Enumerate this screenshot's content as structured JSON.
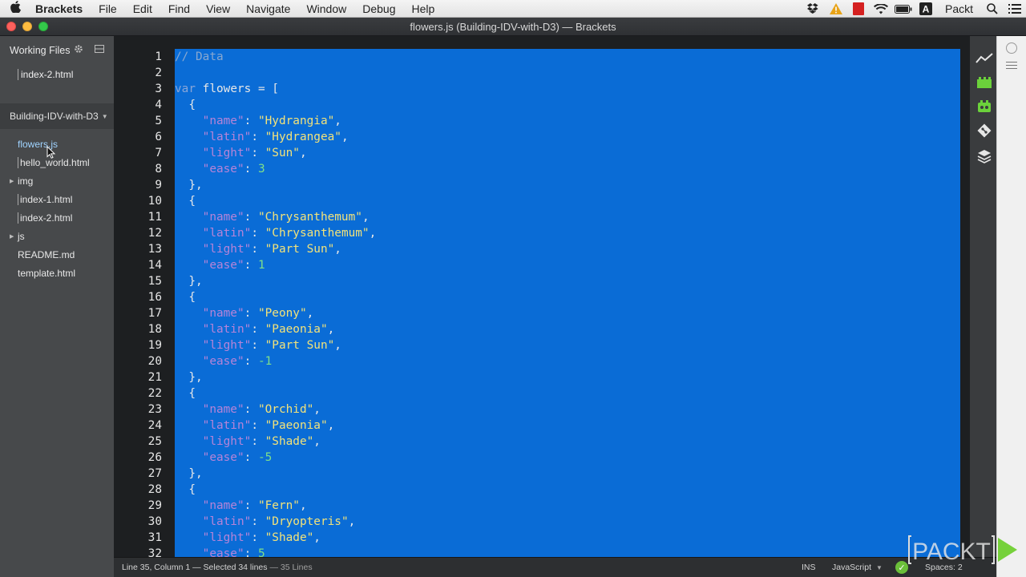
{
  "menubar": {
    "app_name": "Brackets",
    "items": [
      "File",
      "Edit",
      "Find",
      "View",
      "Navigate",
      "Window",
      "Debug",
      "Help"
    ],
    "status_user": "Packt"
  },
  "window": {
    "title": "flowers.js (Building-IDV-with-D3) — Brackets"
  },
  "sidebar": {
    "working_files_label": "Working Files",
    "working_files": [
      "index-2.html"
    ],
    "project_name": "Building-IDV-with-D3",
    "tree": [
      {
        "label": "flowers.js",
        "type": "file",
        "selected": true
      },
      {
        "label": "hello_world.html",
        "type": "file"
      },
      {
        "label": "img",
        "type": "folder"
      },
      {
        "label": "index-1.html",
        "type": "file"
      },
      {
        "label": "index-2.html",
        "type": "file"
      },
      {
        "label": "js",
        "type": "folder"
      },
      {
        "label": "README.md",
        "type": "file"
      },
      {
        "label": "template.html",
        "type": "file"
      }
    ]
  },
  "editor": {
    "lines": [
      [
        [
          "comment",
          "// Data"
        ]
      ],
      [],
      [
        [
          "kw",
          "var"
        ],
        [
          "punc",
          " flowers = ["
        ]
      ],
      [
        [
          "punc",
          "  {"
        ]
      ],
      [
        [
          "key",
          "    \"name\""
        ],
        [
          "punc",
          ": "
        ],
        [
          "str",
          "\"Hydrangia\""
        ],
        [
          "punc",
          ","
        ]
      ],
      [
        [
          "key",
          "    \"latin\""
        ],
        [
          "punc",
          ": "
        ],
        [
          "str",
          "\"Hydrangea\""
        ],
        [
          "punc",
          ","
        ]
      ],
      [
        [
          "key",
          "    \"light\""
        ],
        [
          "punc",
          ": "
        ],
        [
          "str",
          "\"Sun\""
        ],
        [
          "punc",
          ","
        ]
      ],
      [
        [
          "key",
          "    \"ease\""
        ],
        [
          "punc",
          ": "
        ],
        [
          "num",
          "3"
        ]
      ],
      [
        [
          "punc",
          "  },"
        ]
      ],
      [
        [
          "punc",
          "  {"
        ]
      ],
      [
        [
          "key",
          "    \"name\""
        ],
        [
          "punc",
          ": "
        ],
        [
          "str",
          "\"Chrysanthemum\""
        ],
        [
          "punc",
          ","
        ]
      ],
      [
        [
          "key",
          "    \"latin\""
        ],
        [
          "punc",
          ": "
        ],
        [
          "str",
          "\"Chrysanthemum\""
        ],
        [
          "punc",
          ","
        ]
      ],
      [
        [
          "key",
          "    \"light\""
        ],
        [
          "punc",
          ": "
        ],
        [
          "str",
          "\"Part Sun\""
        ],
        [
          "punc",
          ","
        ]
      ],
      [
        [
          "key",
          "    \"ease\""
        ],
        [
          "punc",
          ": "
        ],
        [
          "num",
          "1"
        ]
      ],
      [
        [
          "punc",
          "  },"
        ]
      ],
      [
        [
          "punc",
          "  {"
        ]
      ],
      [
        [
          "key",
          "    \"name\""
        ],
        [
          "punc",
          ": "
        ],
        [
          "str",
          "\"Peony\""
        ],
        [
          "punc",
          ","
        ]
      ],
      [
        [
          "key",
          "    \"latin\""
        ],
        [
          "punc",
          ": "
        ],
        [
          "str",
          "\"Paeonia\""
        ],
        [
          "punc",
          ","
        ]
      ],
      [
        [
          "key",
          "    \"light\""
        ],
        [
          "punc",
          ": "
        ],
        [
          "str",
          "\"Part Sun\""
        ],
        [
          "punc",
          ","
        ]
      ],
      [
        [
          "key",
          "    \"ease\""
        ],
        [
          "punc",
          ": "
        ],
        [
          "num",
          "-1"
        ]
      ],
      [
        [
          "punc",
          "  },"
        ]
      ],
      [
        [
          "punc",
          "  {"
        ]
      ],
      [
        [
          "key",
          "    \"name\""
        ],
        [
          "punc",
          ": "
        ],
        [
          "str",
          "\"Orchid\""
        ],
        [
          "punc",
          ","
        ]
      ],
      [
        [
          "key",
          "    \"latin\""
        ],
        [
          "punc",
          ": "
        ],
        [
          "str",
          "\"Paeonia\""
        ],
        [
          "punc",
          ","
        ]
      ],
      [
        [
          "key",
          "    \"light\""
        ],
        [
          "punc",
          ": "
        ],
        [
          "str",
          "\"Shade\""
        ],
        [
          "punc",
          ","
        ]
      ],
      [
        [
          "key",
          "    \"ease\""
        ],
        [
          "punc",
          ": "
        ],
        [
          "num",
          "-5"
        ]
      ],
      [
        [
          "punc",
          "  },"
        ]
      ],
      [
        [
          "punc",
          "  {"
        ]
      ],
      [
        [
          "key",
          "    \"name\""
        ],
        [
          "punc",
          ": "
        ],
        [
          "str",
          "\"Fern\""
        ],
        [
          "punc",
          ","
        ]
      ],
      [
        [
          "key",
          "    \"latin\""
        ],
        [
          "punc",
          ": "
        ],
        [
          "str",
          "\"Dryopteris\""
        ],
        [
          "punc",
          ","
        ]
      ],
      [
        [
          "key",
          "    \"light\""
        ],
        [
          "punc",
          ": "
        ],
        [
          "str",
          "\"Shade\""
        ],
        [
          "punc",
          ","
        ]
      ],
      [
        [
          "key",
          "    \"ease\""
        ],
        [
          "punc",
          ": "
        ],
        [
          "num",
          "5"
        ]
      ]
    ]
  },
  "statusbar": {
    "position": "Line 35, Column 1 — Selected 34 lines",
    "line_count": "— 35 Lines",
    "mode": "INS",
    "language": "JavaScript",
    "indent": "Spaces: 2"
  },
  "watermark": {
    "text": "PACKT"
  },
  "colors": {
    "selection": "#0a6cd6",
    "editor_bg": "#1d1f21",
    "sidebar_bg": "#47494b"
  },
  "icons": {
    "menubar": [
      "apple-icon",
      "dropbox-icon",
      "warning-icon",
      "red-square-icon",
      "wifi-icon",
      "battery-icon",
      "a-icon",
      "search-icon",
      "list-icon"
    ],
    "righttool": [
      "live-preview-icon",
      "extension-icon",
      "extension-manager-icon",
      "git-icon",
      "layers-icon"
    ]
  }
}
